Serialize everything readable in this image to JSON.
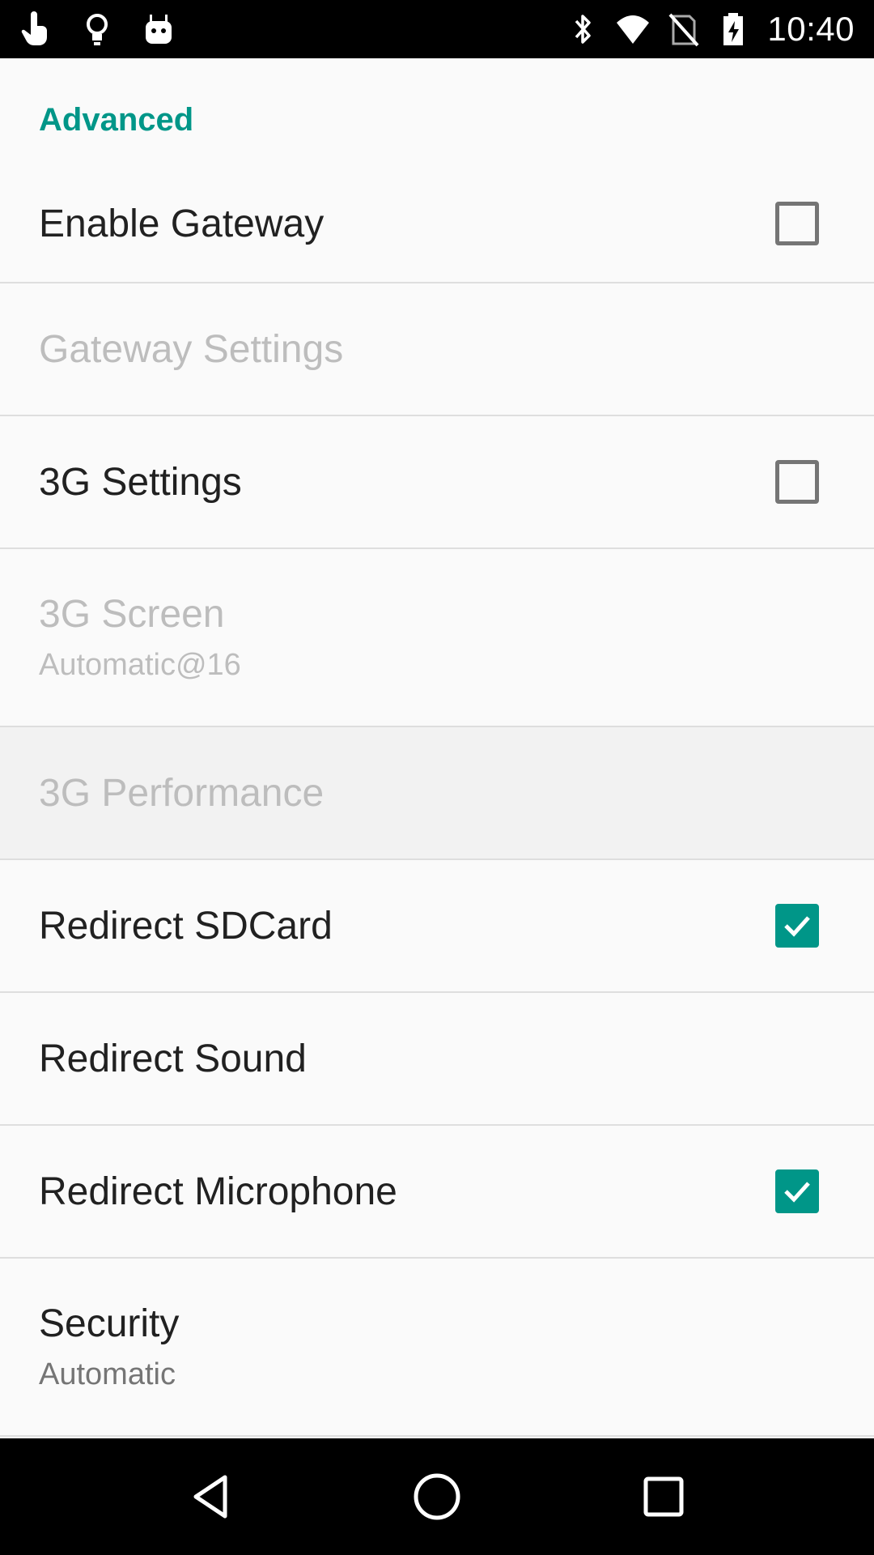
{
  "status_bar": {
    "time": "10:40",
    "left_icons": [
      "hand-pointer-icon",
      "lightbulb-icon",
      "android-icon"
    ],
    "right_icons": [
      "bluetooth-icon",
      "wifi-icon",
      "no-sim-icon",
      "battery-charging-icon"
    ]
  },
  "section": {
    "title": "Advanced",
    "accent_color": "#009688"
  },
  "prefs": [
    {
      "title": "Enable Gateway",
      "summary": "",
      "enabled": true,
      "checkbox": true,
      "checked": false
    },
    {
      "title": "Gateway Settings",
      "summary": "",
      "enabled": false,
      "checkbox": false
    },
    {
      "title": "3G Settings",
      "summary": "",
      "enabled": true,
      "checkbox": true,
      "checked": false
    },
    {
      "title": "3G Screen",
      "summary": "Automatic@16",
      "enabled": false,
      "checkbox": false
    },
    {
      "title": "3G Performance",
      "summary": "",
      "enabled": false,
      "checkbox": false
    },
    {
      "title": "Redirect SDCard",
      "summary": "",
      "enabled": true,
      "checkbox": true,
      "checked": true
    },
    {
      "title": "Redirect Sound",
      "summary": "",
      "enabled": true,
      "checkbox": false
    },
    {
      "title": "Redirect Microphone",
      "summary": "",
      "enabled": true,
      "checkbox": true,
      "checked": true
    },
    {
      "title": "Security",
      "summary": "Automatic",
      "enabled": true,
      "checkbox": false
    }
  ],
  "nav_bar": {
    "buttons": [
      "back-icon",
      "home-icon",
      "recents-icon"
    ]
  }
}
